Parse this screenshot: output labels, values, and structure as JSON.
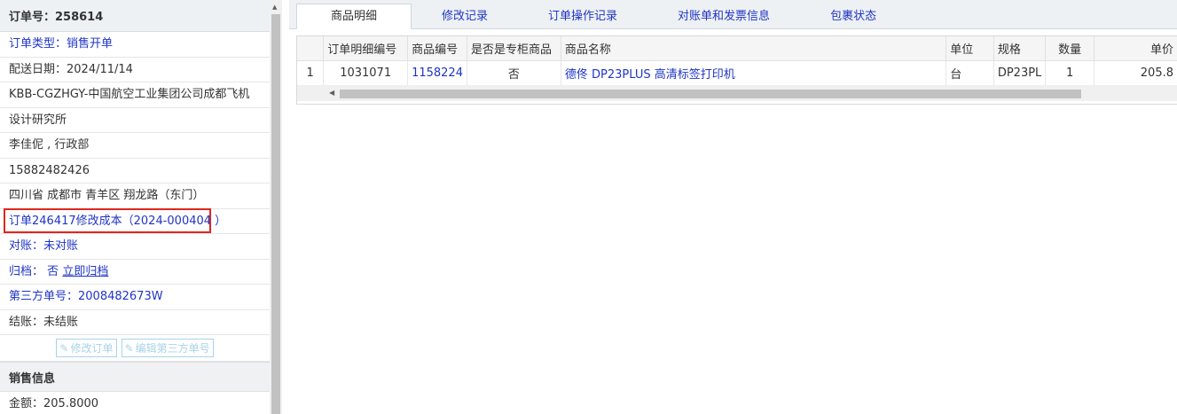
{
  "left": {
    "header": "订单号：258614",
    "rows": {
      "order_type": "订单类型：销售开单",
      "delivery_date": "配送日期：2024/11/14",
      "company": "KBB-CGZHGY-中国航空工业集团公司成都飞机",
      "company2": "设计研究所",
      "contact": "李佳伲 , 行政部",
      "phone": "15882482426",
      "address": "四川省 成都市 青羊区 翔龙路（东门）",
      "cost_change": "订单246417修改成本（2024-000404 ）",
      "reconcile": "对账：未对账",
      "archive_label": "归档：",
      "archive_value": "否",
      "archive_link": "立即归档",
      "third_party": "第三方单号：2008482673W",
      "settlement": "结账：未结账"
    },
    "buttons": {
      "edit_order": "修改订单",
      "edit_third": "编辑第三方单号"
    },
    "sales_section": "销售信息",
    "amount": "金额：205.8000"
  },
  "tabs": [
    "商品明细",
    "修改记录",
    "订单操作记录",
    "对账单和发票信息",
    "包裹状态"
  ],
  "active_tab": 0,
  "grid": {
    "headers": [
      "",
      "订单明细编号",
      "商品编号",
      "是否是专柜商品",
      "商品名称",
      "单位",
      "规格",
      "数量",
      "单价"
    ],
    "rows": [
      {
        "idx": "1",
        "detail_no": "1031071",
        "product_no": "1158224",
        "counter": "否",
        "name": "德佟 DP23PLUS 高清标签打印机",
        "unit": "台",
        "spec": "DP23PL",
        "qty": "1",
        "price": "205.8"
      }
    ]
  },
  "colors": {
    "accent": "#1f35c5",
    "highlight": "#e0261e"
  }
}
